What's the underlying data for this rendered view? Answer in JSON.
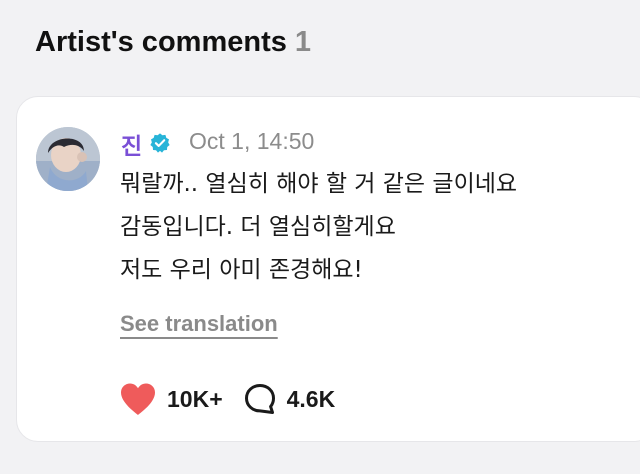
{
  "section": {
    "title": "Artist's comments",
    "count": "1"
  },
  "comment": {
    "author": "진",
    "verified": true,
    "timestamp": "Oct 1, 14:50",
    "lines": [
      "뭐랄까.. 열심히 해야 할 거 같은 글이네요",
      "감동입니다. 더 열심히할게요",
      "저도 우리 아미 존경해요!"
    ],
    "translate_label": "See translation",
    "likes": "10K+",
    "replies": "4.6K"
  },
  "colors": {
    "author_name": "#7a4fd6",
    "verified_badge": "#27b4d8",
    "like_heart": "#ef5b5b",
    "muted_text": "#8a8a8a"
  },
  "icons": [
    "verified-badge-icon",
    "heart-icon",
    "comment-bubble-icon"
  ]
}
